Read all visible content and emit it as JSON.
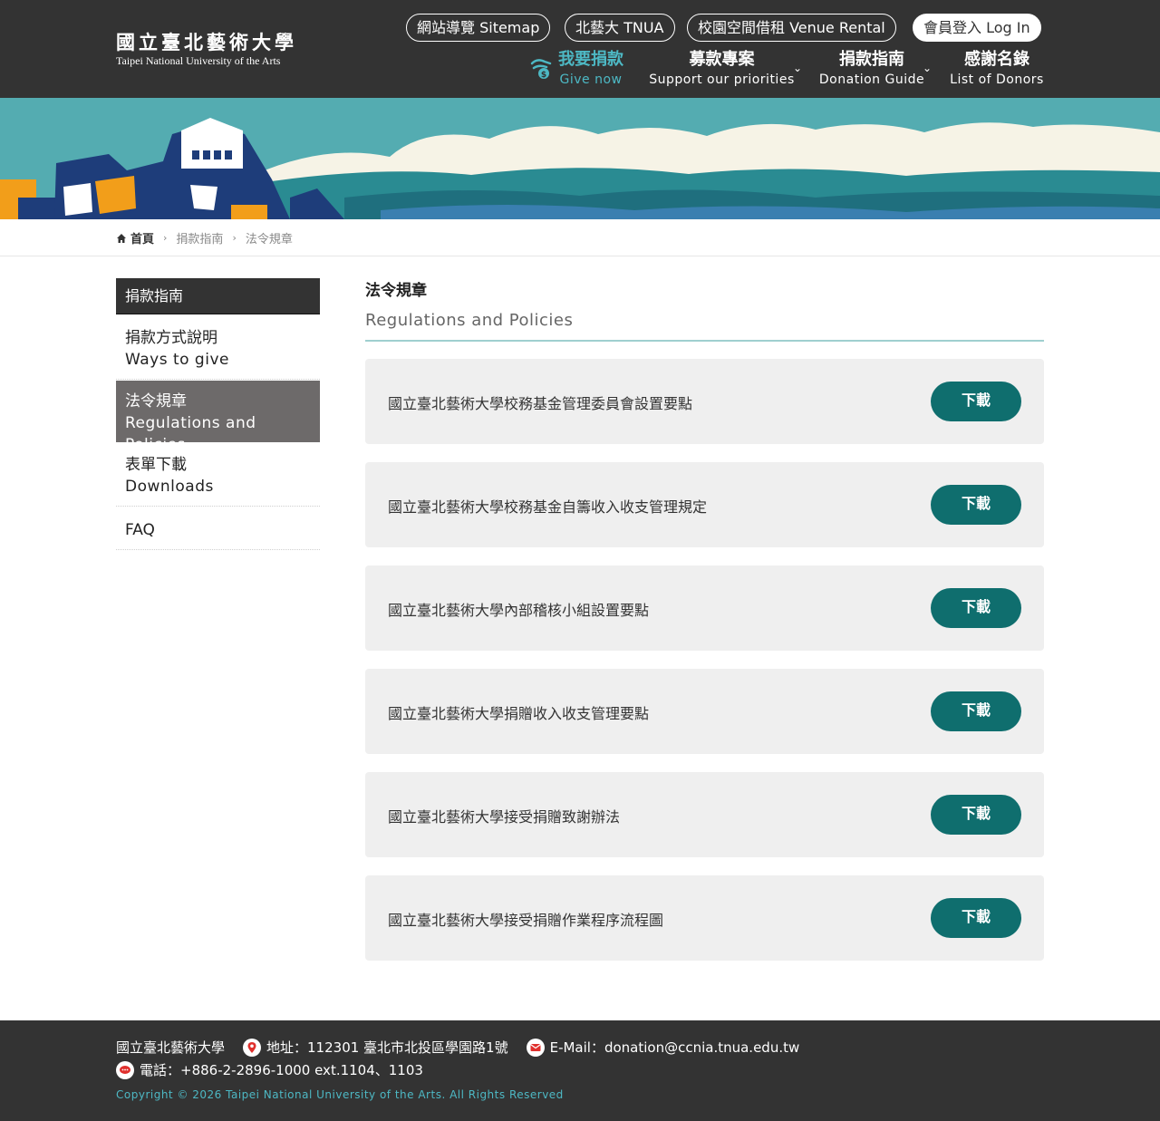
{
  "header": {
    "logo_zh": "國立臺北藝術大學",
    "logo_en": "Taipei National University of the Arts",
    "top_links": [
      {
        "label": "網站導覽 Sitemap"
      },
      {
        "label": "北藝大 TNUA"
      },
      {
        "label": "校園空間借租 Venue Rental"
      },
      {
        "label": "會員登入 Log In"
      }
    ],
    "nav": [
      {
        "zh": "我要捐款",
        "en": "Give now"
      },
      {
        "zh": "募款專案",
        "en": "Support our priorities"
      },
      {
        "zh": "捐款指南",
        "en": "Donation Guide"
      },
      {
        "zh": "感謝名錄",
        "en": "List of Donors"
      }
    ]
  },
  "breadcrumb": {
    "home": "首頁",
    "level1": "捐款指南",
    "current": "法令規章"
  },
  "sidebar": {
    "title": "捐款指南",
    "items": [
      {
        "zh": "捐款方式說明",
        "en": "Ways to give"
      },
      {
        "zh": "法令規章",
        "en": "Regulations and Policies"
      },
      {
        "zh": "表單下載",
        "en": "Downloads"
      },
      {
        "zh": "FAQ",
        "en": ""
      }
    ]
  },
  "main": {
    "title": "法令規章",
    "subtitle": "Regulations and Policies",
    "download_label": "下載",
    "documents": [
      {
        "name": "國立臺北藝術大學校務基金管理委員會設置要點"
      },
      {
        "name": "國立臺北藝術大學校務基金自籌收入收支管理規定"
      },
      {
        "name": "國立臺北藝術大學內部稽核小組設置要點"
      },
      {
        "name": "國立臺北藝術大學捐贈收入收支管理要點"
      },
      {
        "name": "國立臺北藝術大學接受捐贈致謝辦法"
      },
      {
        "name": "國立臺北藝術大學接受捐贈作業程序流程圖"
      }
    ]
  },
  "footer": {
    "org": "國立臺北藝術大學",
    "address": "地址：112301 臺北市北投區學園路1號",
    "email": "E-Mail：donation@ccnia.tnua.edu.tw",
    "phone": "電話：+886-2-2896-1000 ext.1104、1103",
    "copyright": "Copyright © 2026 Taipei National University of the Arts. All Rights Reserved"
  },
  "colors": {
    "header_bg": "#333333",
    "accent_teal": "#0f6e6e",
    "active_nav": "#4db8c4",
    "sidebar_active": "#6d6a6a"
  }
}
